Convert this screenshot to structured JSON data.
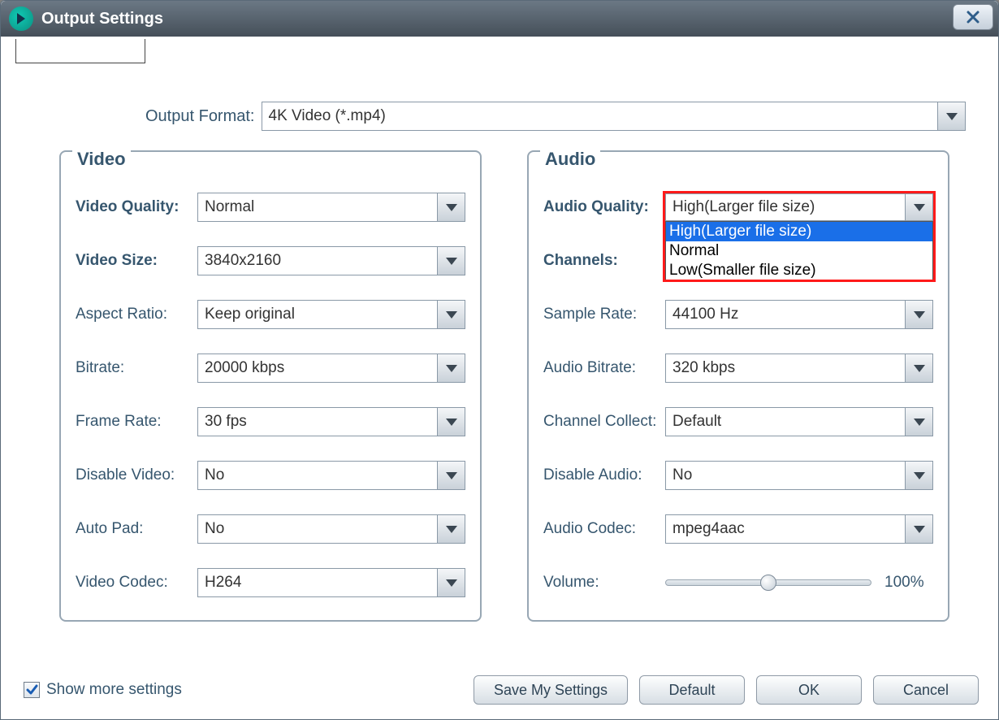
{
  "window": {
    "title": "Output Settings"
  },
  "outputFormat": {
    "label": "Output Format:",
    "value": "4K Video (*.mp4)"
  },
  "video": {
    "legend": "Video",
    "quality": {
      "label": "Video Quality:",
      "value": "Normal",
      "bold": true
    },
    "size": {
      "label": "Video Size:",
      "value": "3840x2160",
      "bold": true
    },
    "aspect": {
      "label": "Aspect Ratio:",
      "value": "Keep original"
    },
    "bitrate": {
      "label": "Bitrate:",
      "value": "20000 kbps"
    },
    "framerate": {
      "label": "Frame Rate:",
      "value": "30 fps"
    },
    "disable": {
      "label": "Disable Video:",
      "value": "No"
    },
    "autopad": {
      "label": "Auto Pad:",
      "value": "No"
    },
    "codec": {
      "label": "Video Codec:",
      "value": "H264"
    }
  },
  "audio": {
    "legend": "Audio",
    "quality": {
      "label": "Audio Quality:",
      "value": "High(Larger file size)",
      "bold": true,
      "options": [
        "High(Larger file size)",
        "Normal",
        "Low(Smaller file size)"
      ],
      "selectedIndex": 0,
      "open": true,
      "highlighted": true
    },
    "channels": {
      "label": "Channels:",
      "bold": true
    },
    "samplerate": {
      "label": "Sample Rate:",
      "value": "44100 Hz"
    },
    "bitrate": {
      "label": "Audio Bitrate:",
      "value": "320 kbps"
    },
    "chcollect": {
      "label": "Channel Collect:",
      "value": "Default"
    },
    "disable": {
      "label": "Disable Audio:",
      "value": "No"
    },
    "codec": {
      "label": "Audio Codec:",
      "value": "mpeg4aac"
    },
    "volume": {
      "label": "Volume:",
      "percent": 50,
      "text": "100%"
    }
  },
  "footer": {
    "showMore": {
      "label": "Show more settings",
      "checked": true
    },
    "save": "Save My Settings",
    "default": "Default",
    "ok": "OK",
    "cancel": "Cancel"
  }
}
